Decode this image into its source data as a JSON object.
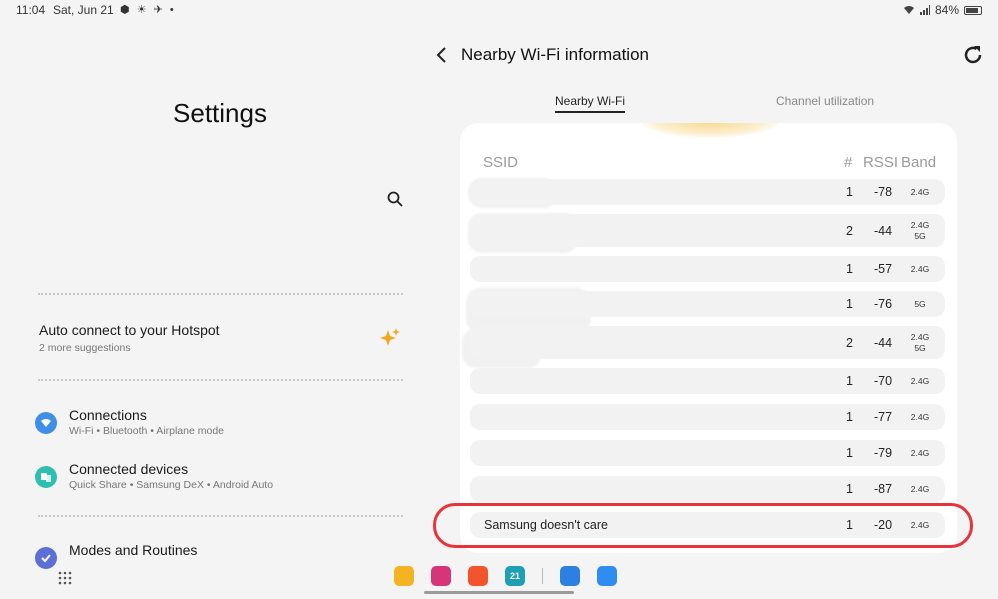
{
  "status_bar": {
    "time": "11:04",
    "date": "Sat, Jun 21",
    "icons": "⬢ ☀ ✈ •",
    "battery": "84%"
  },
  "settings": {
    "title": "Settings",
    "suggestion": {
      "title": "Auto connect to your Hotspot",
      "subtitle": "2 more suggestions"
    },
    "items": [
      {
        "title": "Connections",
        "subtitle": "Wi-Fi  •  Bluetooth  •  Airplane mode",
        "color": "#3f8ee8"
      },
      {
        "title": "Connected devices",
        "subtitle": "Quick Share  •  Samsung DeX  •  Android Auto",
        "color": "#2fbfae"
      },
      {
        "title": "Modes and Routines",
        "subtitle": "",
        "color": "#5c6fd6"
      }
    ]
  },
  "wifi_panel": {
    "title": "Nearby Wi-Fi information",
    "tabs": [
      "Nearby Wi-Fi",
      "Channel utilization"
    ],
    "columns": {
      "ssid": "SSID",
      "num": "#",
      "rssi": "RSSI",
      "band": "Band"
    },
    "rows": [
      {
        "ssid": "",
        "num": "1",
        "rssi": "-78",
        "band": [
          "2.4G"
        ]
      },
      {
        "ssid": "",
        "num": "2",
        "rssi": "-44",
        "band": [
          "2.4G",
          "5G"
        ]
      },
      {
        "ssid": "",
        "num": "1",
        "rssi": "-57",
        "band": [
          "2.4G"
        ]
      },
      {
        "ssid": "",
        "num": "1",
        "rssi": "-76",
        "band": [
          "5G"
        ]
      },
      {
        "ssid": "",
        "num": "2",
        "rssi": "-44",
        "band": [
          "2.4G",
          "5G"
        ]
      },
      {
        "ssid": "",
        "num": "1",
        "rssi": "-70",
        "band": [
          "2.4G"
        ]
      },
      {
        "ssid": "",
        "num": "1",
        "rssi": "-77",
        "band": [
          "2.4G"
        ]
      },
      {
        "ssid": "",
        "num": "1",
        "rssi": "-79",
        "band": [
          "2.4G"
        ]
      },
      {
        "ssid": "",
        "num": "1",
        "rssi": "-87",
        "band": [
          "2.4G"
        ]
      },
      {
        "ssid": "Samsung doesn't care",
        "num": "1",
        "rssi": "-20",
        "band": [
          "2.4G"
        ]
      }
    ]
  },
  "dock": {
    "apps": [
      {
        "name": "my-files",
        "color": "#f5b324",
        "glyph": ""
      },
      {
        "name": "instagram",
        "color": "#d6357a",
        "glyph": ""
      },
      {
        "name": "brave",
        "color": "#f2542d",
        "glyph": ""
      },
      {
        "name": "calendar",
        "color": "#1e9fb3",
        "glyph": "21"
      },
      {
        "name": "sync-app",
        "color": "#2d7fe0",
        "glyph": ""
      },
      {
        "name": "play-app",
        "color": "#2f8cf0",
        "glyph": ""
      }
    ]
  }
}
